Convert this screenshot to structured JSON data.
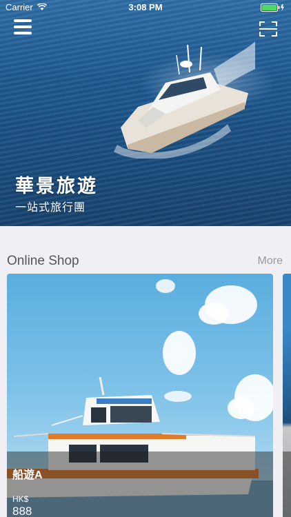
{
  "status_bar": {
    "carrier": "Carrier",
    "time": "3:08 PM"
  },
  "hero": {
    "title": "華景旅遊",
    "subtitle": "一站式旅行團"
  },
  "online_shop": {
    "title": "Online Shop",
    "more_label": "More",
    "products": [
      {
        "name": "船遊A",
        "currency": "HK$",
        "price": "888"
      }
    ]
  },
  "colors": {
    "background": "#efeff4",
    "sea": "#1f5a92",
    "sky": "#7cc1e8"
  }
}
